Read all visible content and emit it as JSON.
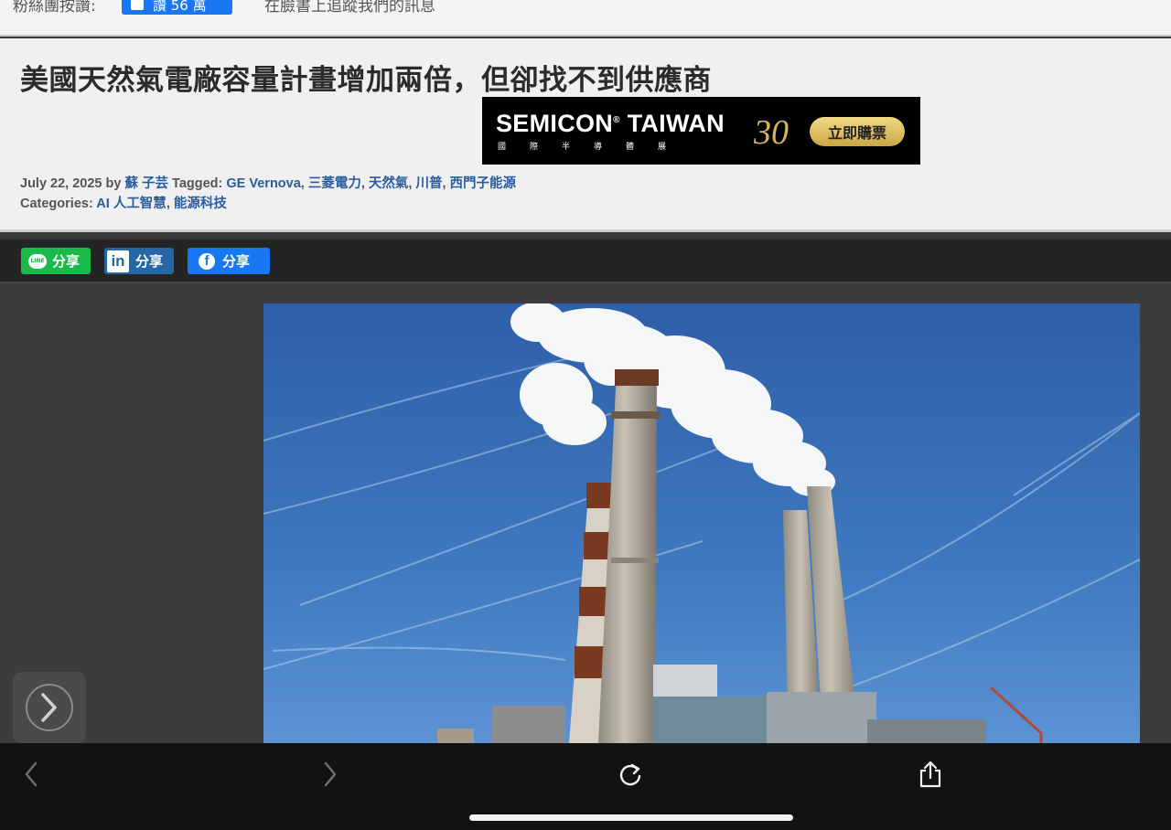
{
  "top_strip": {
    "fans_label": "粉絲團按讚:",
    "like_button_label": "讚 56 萬",
    "follow_text": "在臉書上追蹤我們的訊息"
  },
  "article": {
    "title": "美國天然氣電廠容量計畫增加兩倍，但卻找不到供應商",
    "date": "July 22, 2025",
    "by_label": "by",
    "author": "蘇 子芸",
    "tagged_label": "Tagged:",
    "tags": [
      "GE Vernova",
      "三菱電力",
      "天然氣",
      "川普",
      "西門子能源"
    ],
    "categories_label": "Categories:",
    "categories": [
      "AI 人工智慧",
      "能源科技"
    ]
  },
  "ad": {
    "main_text": "SEMICON",
    "reg_mark": "®",
    "main_text_2": "TAIWAN",
    "sub_text": "國際半導體展",
    "anniversary": "30",
    "cta_label": "立即購票"
  },
  "share": {
    "line_label": "分享",
    "line_badge": "LINE",
    "linkedin_label": "分享",
    "linkedin_badge": "in",
    "facebook_label": "分享",
    "facebook_badge": "f"
  },
  "icons": {
    "back": "chevron-left-icon",
    "forward": "chevron-right-icon",
    "reload": "reload-icon",
    "share": "share-icon",
    "next_floating": "chevron-right-icon"
  },
  "colors": {
    "line_green": "#19b94a",
    "linkedin_blue": "#2467a6",
    "facebook_blue": "#1877f2",
    "link_blue": "#2a5d9f",
    "ad_gold": "#d7b45a"
  }
}
